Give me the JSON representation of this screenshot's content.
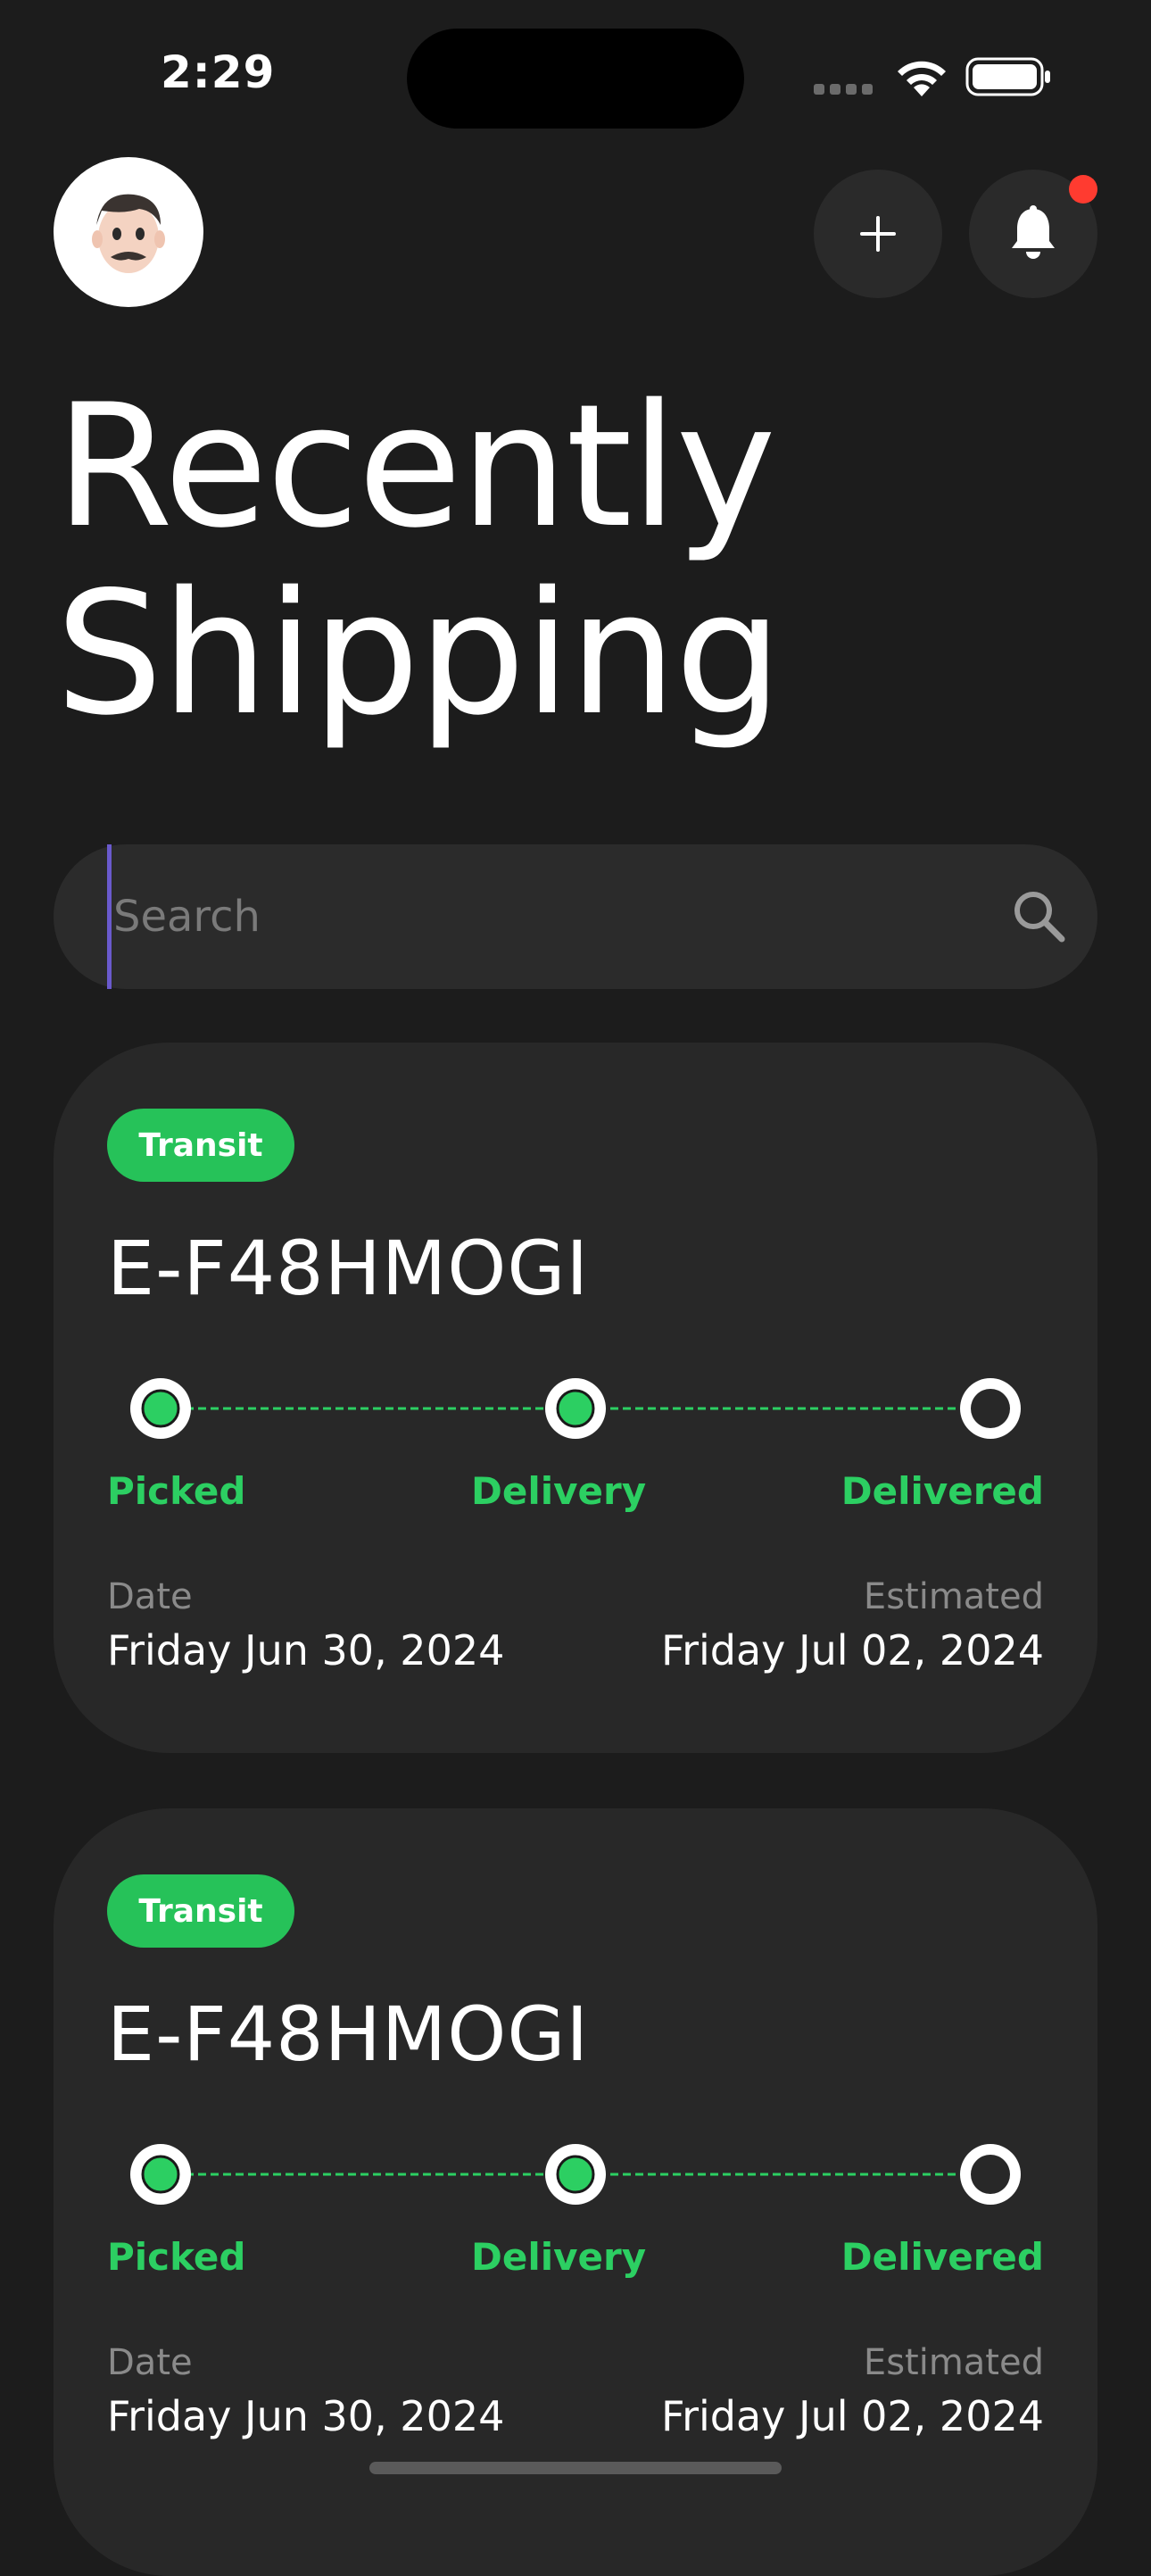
{
  "status_bar": {
    "time": "2:29",
    "icons": [
      "cellular-dots-icon",
      "wifi-icon",
      "battery-icon"
    ]
  },
  "header": {
    "avatar": "memoji-avatar",
    "add_icon": "plus-icon",
    "bell_icon": "bell-icon",
    "has_notification": true
  },
  "page": {
    "title_line1": "Recently",
    "title_line2": "Shipping"
  },
  "search": {
    "placeholder": "Search",
    "value": ""
  },
  "shipments": [
    {
      "status": "Transit",
      "id": "E-F48HMOGI",
      "steps": [
        {
          "label": "Picked",
          "done": true
        },
        {
          "label": "Delivery",
          "done": true
        },
        {
          "label": "Delivered",
          "done": false
        }
      ],
      "date_label": "Date",
      "date_value": "Friday Jun 30, 2024",
      "estimated_label": "Estimated",
      "estimated_value": "Friday Jul 02, 2024"
    },
    {
      "status": "Transit",
      "id": "E-F48HMOGI",
      "steps": [
        {
          "label": "Picked",
          "done": true
        },
        {
          "label": "Delivery",
          "done": true
        },
        {
          "label": "Delivered",
          "done": false
        }
      ],
      "date_label": "Date",
      "date_value": "Friday Jun 30, 2024",
      "estimated_label": "Estimated",
      "estimated_value": "Friday Jul 02, 2024"
    }
  ],
  "colors": {
    "background": "#1c1c1c",
    "card": "#282828",
    "accent_green": "#26c259",
    "notification_red": "#ff3b30"
  }
}
